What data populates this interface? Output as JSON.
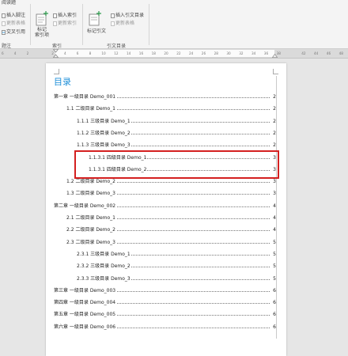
{
  "ribbon": {
    "tab_label": "阅读题",
    "insert_footnote": "插入脚注",
    "update_table": "更新表格",
    "cross_ref": "交叉引用",
    "mark_index_entry": "标记\n索引项",
    "insert_index": "插入索引",
    "update_index": "更新索引",
    "mark_citation": "标记引文",
    "insert_table_of_authorities": "插入引文目录",
    "update_authorities": "更新表格",
    "group_footnotes": "题注",
    "group_index": "索引",
    "group_citations": "引文目录"
  },
  "ruler": {
    "ticks": [
      "6",
      "4",
      "2",
      "",
      "2",
      "4",
      "6",
      "8",
      "10",
      "12",
      "14",
      "16",
      "18",
      "20",
      "22",
      "24",
      "26",
      "28",
      "30",
      "32",
      "34",
      "36",
      "38",
      "",
      "42",
      "44",
      "46",
      "48"
    ]
  },
  "document": {
    "toc_title": "目录",
    "entries": [
      {
        "text": "第一章  一级目录 Demo_001",
        "page": "2",
        "level": 0
      },
      {
        "text": "1.1  二级目录 Demo_1",
        "page": "2",
        "level": 1
      },
      {
        "text": "1.1.1  三级目录 Demo_1",
        "page": "2",
        "level": 2
      },
      {
        "text": "1.1.2  三级目录 Demo_2",
        "page": "2",
        "level": 2
      },
      {
        "text": "1.1.3  三级目录 Demo_3",
        "page": "2",
        "level": 2
      },
      {
        "text": "1.1.3.1  四级目录 Demo_1",
        "page": "3",
        "level": 3
      },
      {
        "text": "1.1.3.1  四级目录 Demo_2",
        "page": "3",
        "level": 3
      },
      {
        "text": "1.2  二级目录 Demo_2",
        "page": "3",
        "level": 1
      },
      {
        "text": "1.3  二级目录 Demo_3",
        "page": "3",
        "level": 1
      },
      {
        "text": "第二章  一级目录 Demo_002",
        "page": "4",
        "level": 0
      },
      {
        "text": "2.1  二级目录 Demo_1",
        "page": "4",
        "level": 1
      },
      {
        "text": "2.2  二级目录 Demo_2",
        "page": "4",
        "level": 1
      },
      {
        "text": "2.3  二级目录 Demo_3",
        "page": "5",
        "level": 1
      },
      {
        "text": "2.3.1  三级目录 Demo_1",
        "page": "5",
        "level": 2
      },
      {
        "text": "2.3.2  三级目录 Demo_2",
        "page": "5",
        "level": 2
      },
      {
        "text": "2.3.3  三级目录 Demo_3",
        "page": "5",
        "level": 2
      },
      {
        "text": "第三章  一级目录 Demo_003",
        "page": "6",
        "level": 0
      },
      {
        "text": "第四章  一级目录 Demo_004",
        "page": "6",
        "level": 0
      },
      {
        "text": "第五章  一级目录 Demo_005",
        "page": "6",
        "level": 0
      },
      {
        "text": "第六章  一级目录 Demo_006",
        "page": "6",
        "level": 0
      }
    ]
  },
  "colors": {
    "title_blue": "#1e8fd8",
    "highlight_red": "#d42020"
  }
}
